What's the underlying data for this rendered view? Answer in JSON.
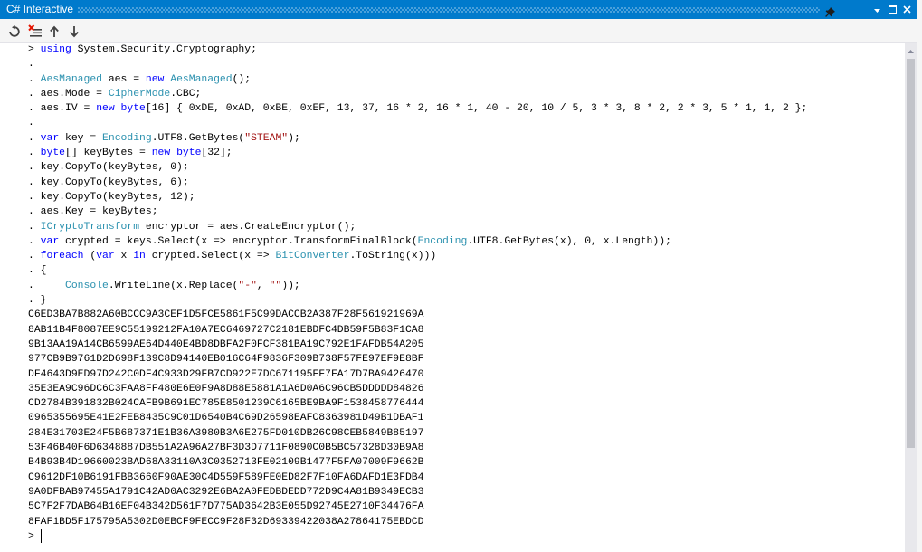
{
  "title_bar": {
    "title": "C# Interactive",
    "icons": [
      "pin-icon",
      "dropdown-arrow-icon",
      "maximize-icon",
      "close-icon"
    ]
  },
  "toolbar": {
    "buttons": [
      {
        "icon": "reset-icon"
      },
      {
        "icon": "clear-icon"
      },
      {
        "icon": "arrow-up-icon"
      },
      {
        "icon": "arrow-down-icon"
      }
    ]
  },
  "colors": {
    "title_bar": "#007ACC",
    "title_text": "#FFFFFF",
    "editor_background": "#FFFFFF",
    "plain_text": "#000000",
    "keyword": "#0000FF",
    "type": "#2B91AF",
    "string": "#A31515"
  },
  "console": {
    "lines": [
      {
        "prompt": ">",
        "tokens": [
          {
            "text": "using",
            "color": "#0000FF"
          },
          {
            "text": " System.Security.Cryptography;"
          }
        ]
      },
      {
        "prompt": ".",
        "tokens": []
      },
      {
        "prompt": ".",
        "tokens": [
          {
            "text": "AesManaged",
            "color": "#2B91AF"
          },
          {
            "text": " aes = "
          },
          {
            "text": "new",
            "color": "#0000FF"
          },
          {
            "text": " "
          },
          {
            "text": "AesManaged",
            "color": "#2B91AF"
          },
          {
            "text": "();"
          }
        ]
      },
      {
        "prompt": ".",
        "tokens": [
          {
            "text": "aes.Mode = "
          },
          {
            "text": "CipherMode",
            "color": "#2B91AF"
          },
          {
            "text": ".CBC;"
          }
        ]
      },
      {
        "prompt": ".",
        "tokens": [
          {
            "text": "aes.IV = "
          },
          {
            "text": "new",
            "color": "#0000FF"
          },
          {
            "text": " "
          },
          {
            "text": "byte",
            "color": "#0000FF"
          },
          {
            "text": "[16] { 0xDE, 0xAD, 0xBE, 0xEF, 13, 37, 16 * 2, 16 * 1, 40 - 20, 10 / 5, 3 * 3, 8 * 2, 2 * 3, 5 * 1, 1, 2 };"
          }
        ]
      },
      {
        "prompt": ".",
        "tokens": []
      },
      {
        "prompt": ".",
        "tokens": [
          {
            "text": "var",
            "color": "#0000FF"
          },
          {
            "text": " key = "
          },
          {
            "text": "Encoding",
            "color": "#2B91AF"
          },
          {
            "text": ".UTF8.GetBytes("
          },
          {
            "text": "\"STEAM\"",
            "color": "#A31515"
          },
          {
            "text": ");"
          }
        ]
      },
      {
        "prompt": ".",
        "tokens": [
          {
            "text": "byte",
            "color": "#0000FF"
          },
          {
            "text": "[] keyBytes = "
          },
          {
            "text": "new",
            "color": "#0000FF"
          },
          {
            "text": " "
          },
          {
            "text": "byte",
            "color": "#0000FF"
          },
          {
            "text": "[32];"
          }
        ]
      },
      {
        "prompt": ".",
        "tokens": [
          {
            "text": "key.CopyTo(keyBytes, 0);"
          }
        ]
      },
      {
        "prompt": ".",
        "tokens": [
          {
            "text": "key.CopyTo(keyBytes, 6);"
          }
        ]
      },
      {
        "prompt": ".",
        "tokens": [
          {
            "text": "key.CopyTo(keyBytes, 12);"
          }
        ]
      },
      {
        "prompt": ".",
        "tokens": [
          {
            "text": "aes.Key = keyBytes;"
          }
        ]
      },
      {
        "prompt": ".",
        "tokens": [
          {
            "text": "ICryptoTransform",
            "color": "#2B91AF"
          },
          {
            "text": " encryptor = aes.CreateEncryptor();"
          }
        ]
      },
      {
        "prompt": ".",
        "tokens": [
          {
            "text": "var",
            "color": "#0000FF"
          },
          {
            "text": " crypted = keys.Select(x => encryptor.TransformFinalBlock("
          },
          {
            "text": "Encoding",
            "color": "#2B91AF"
          },
          {
            "text": ".UTF8.GetBytes(x), 0, x.Length));"
          }
        ]
      },
      {
        "prompt": ".",
        "tokens": [
          {
            "text": "foreach",
            "color": "#0000FF"
          },
          {
            "text": " ("
          },
          {
            "text": "var",
            "color": "#0000FF"
          },
          {
            "text": " x "
          },
          {
            "text": "in",
            "color": "#0000FF"
          },
          {
            "text": " crypted.Select(x => "
          },
          {
            "text": "BitConverter",
            "color": "#2B91AF"
          },
          {
            "text": ".ToString(x)))"
          }
        ]
      },
      {
        "prompt": ".",
        "tokens": [
          {
            "text": "{"
          }
        ]
      },
      {
        "prompt": ".",
        "tokens": [
          {
            "text": "    "
          },
          {
            "text": "Console",
            "color": "#2B91AF"
          },
          {
            "text": ".WriteLine(x.Replace("
          },
          {
            "text": "\"-\"",
            "color": "#A31515"
          },
          {
            "text": ", "
          },
          {
            "text": "\"\"",
            "color": "#A31515"
          },
          {
            "text": "));"
          }
        ]
      },
      {
        "prompt": ".",
        "tokens": [
          {
            "text": "}"
          }
        ]
      },
      {
        "text": "C6ED3BA7B882A60BCCC9A3CEF1D5FCE5861F5C99DACCB2A387F28F561921969A"
      },
      {
        "text": "8AB11B4F8087EE9C55199212FA10A7EC6469727C2181EBDFC4DB59F5B83F1CA8"
      },
      {
        "text": "9B13AA19A14CB6599AE64D440E4BD8DBFA2F0FCF381BA19C792E1FAFDB54A205"
      },
      {
        "text": "977CB9B9761D2D698F139C8D94140EB016C64F9836F309B738F57FE97EF9E8BF"
      },
      {
        "text": "DF4643D9ED97D242C0DF4C933D29FB7CD922E7DC671195FF7FA17D7BA9426470"
      },
      {
        "text": "35E3EA9C96DC6C3FAA8FF480E6E0F9A8D88E5881A1A6D0A6C96CB5DDDDD84826"
      },
      {
        "text": "CD2784B391832B024CAFB9B691EC785E8501239C6165BE9BA9F1538458776444"
      },
      {
        "text": "0965355695E41E2FEB8435C9C01D6540B4C69D26598EAFC8363981D49B1DBAF1"
      },
      {
        "text": "284E31703E24F5B687371E1B36A3980B3A6E275FD010DB26C98CEB5849B85197"
      },
      {
        "text": "53F46B40F6D6348887DB551A2A96A27BF3D3D7711F0890C0B5BC57328D30B9A8"
      },
      {
        "text": "B4B93B4D19660023BAD68A33110A3C0352713FE02109B1477F5FA07009F9662B"
      },
      {
        "text": "C9612DF10B6191FBB3660F90AE30C4D559F589FE0ED82F7F10FA6DAFD1E3FDB4"
      },
      {
        "text": "9A0DFBAB97455A1791C42AD0AC3292E6BA2A0FEDBDEDD772D9C4A81B9349ECB3"
      },
      {
        "text": "5C7F2F7DAB64B16EF04B342D561F7D775AD3642B3E055D92745E2710F34476FA"
      },
      {
        "text": "8FAF1BD5F175795A5302D0EBCF9FECC9F28F32D69339422038A27864175EBDCD"
      },
      {
        "prompt": ">",
        "tokens": [],
        "caret": true
      }
    ]
  }
}
